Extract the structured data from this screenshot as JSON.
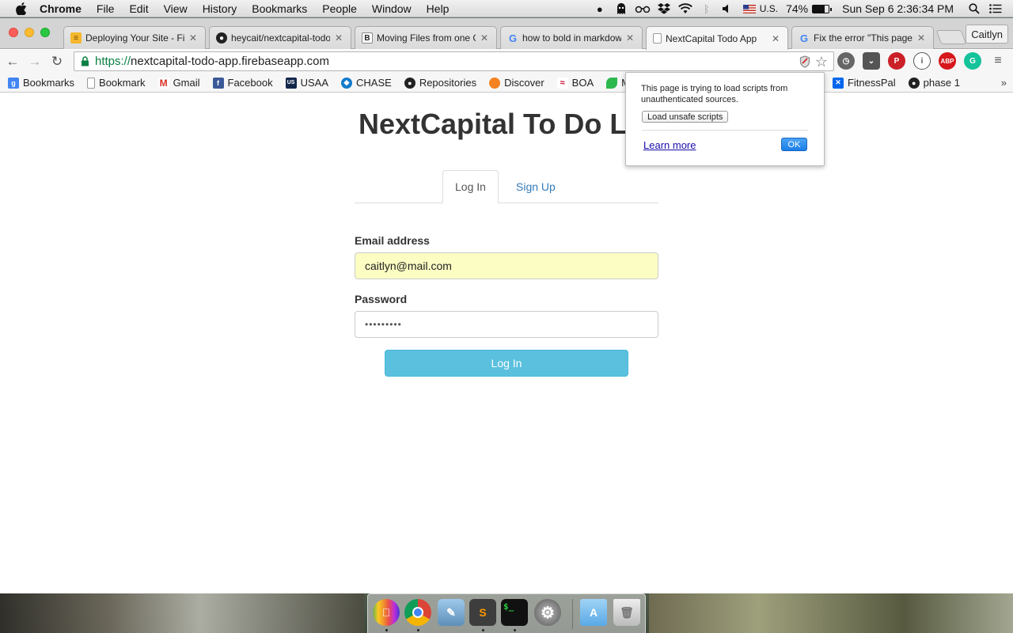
{
  "menubar": {
    "app_name": "Chrome",
    "items": [
      "File",
      "Edit",
      "View",
      "History",
      "Bookmarks",
      "People",
      "Window",
      "Help"
    ],
    "input_source": "U.S.",
    "battery": "74%",
    "battery_level": 0.74,
    "datetime": "Sun Sep 6  2:36:34 PM"
  },
  "tabs": [
    {
      "title": "Deploying Your Site - Fir",
      "icon": "firebase-icon"
    },
    {
      "title": "heycait/nextcapital-todo",
      "icon": "github-icon"
    },
    {
      "title": "Moving Files from one Git",
      "icon": "bitbucket-icon"
    },
    {
      "title": "how to bold in markdown",
      "icon": "google-icon"
    },
    {
      "title": "NextCapital Todo App",
      "icon": "page-icon",
      "active": true
    },
    {
      "title": "Fix the error \"This page is",
      "icon": "google-icon"
    }
  ],
  "profile_name": "Caitlyn",
  "address": {
    "scheme": "https://",
    "host": "nextcapital-todo-app.firebaseapp.com"
  },
  "bookmarks": [
    {
      "label": "Bookmarks",
      "icon": "apps-icon"
    },
    {
      "label": "Bookmark",
      "icon": "page-icon"
    },
    {
      "label": "Gmail",
      "icon": "gmail-icon"
    },
    {
      "label": "Facebook",
      "icon": "facebook-icon"
    },
    {
      "label": "USAA",
      "icon": "usaa-icon"
    },
    {
      "label": "CHASE",
      "icon": "chase-icon"
    },
    {
      "label": "Repositories",
      "icon": "github-icon"
    },
    {
      "label": "Discover",
      "icon": "discover-icon"
    },
    {
      "label": "BOA",
      "icon": "boa-icon"
    },
    {
      "label": "M",
      "icon": "leaf-icon"
    },
    {
      "label": "FitnessPal",
      "icon": "fitnesspal-icon"
    },
    {
      "label": "phase 1",
      "icon": "github-icon"
    }
  ],
  "bubble": {
    "message": "This page is trying to load scripts from unauthenticated sources.",
    "unsafe_button": "Load unsafe scripts",
    "learn_more": "Learn more",
    "ok": "OK"
  },
  "page": {
    "title": "NextCapital To Do List",
    "tab_login": "Log In",
    "tab_signup": "Sign Up",
    "email_label": "Email address",
    "email_value": "caitlyn@mail.com",
    "password_label": "Password",
    "password_value": "•••••••••",
    "submit_label": "Log In"
  },
  "colors": {
    "accent": "#337ab7",
    "button": "#5bc0de",
    "autofill": "#fbfdc3",
    "secure": "#0b8043"
  },
  "dock": [
    {
      "name": "finder-icon"
    },
    {
      "name": "chrome-icon"
    },
    {
      "name": "preview-icon"
    },
    {
      "name": "sublime-text-icon"
    },
    {
      "name": "terminal-icon"
    },
    {
      "name": "system-preferences-icon"
    },
    {
      "name": "applications-folder-icon"
    },
    {
      "name": "trash-icon"
    }
  ]
}
